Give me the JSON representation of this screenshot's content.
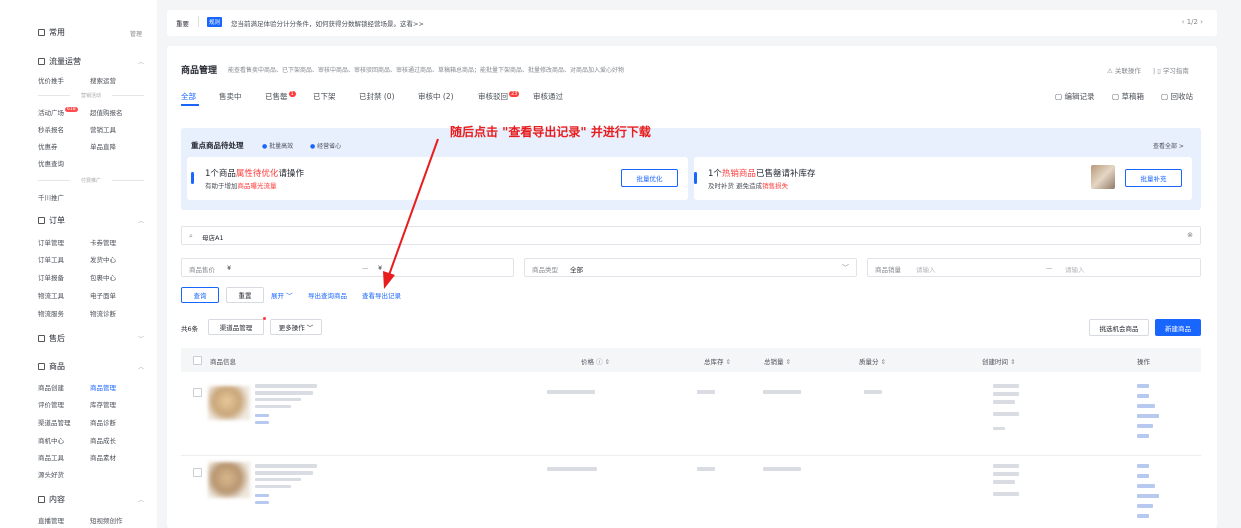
{
  "sidebar": {
    "common_title": "常用",
    "manage": "管理",
    "traffic_title": "流量运营",
    "row1a": "优价推手",
    "row1b": "搜索运营",
    "group_activity": "营销活动",
    "row2a": "活动广场",
    "row2a_badge": "618",
    "row2b": "超值购报名",
    "row3a": "秒杀报名",
    "row3b": "营销工具",
    "row4a": "优惠券",
    "row4b": "单品直降",
    "row5a": "优惠查询",
    "group_promo": "付费推广",
    "row6a": "千川推广",
    "order_title": "订单",
    "o1a": "订单管理",
    "o1b": "卡券管理",
    "o2a": "订单工具",
    "o2b": "发货中心",
    "o3a": "订单报备",
    "o3b": "包裹中心",
    "o4a": "物流工具",
    "o4b": "电子面单",
    "o5a": "物流服务",
    "o5b": "物流诊断",
    "after_title": "售后",
    "goods_title": "商品",
    "g1a": "商品创建",
    "g1b": "商品管理",
    "g2a": "评价管理",
    "g2b": "库存管理",
    "g3a": "渠道品管理",
    "g3b": "商品诊断",
    "g4a": "商机中心",
    "g4b": "商品成长",
    "g5a": "商品工具",
    "g5b": "商品素材",
    "g6a": "源头好货",
    "content_title": "内容",
    "c1a": "直播管理",
    "c1b": "短视频创作"
  },
  "notice": {
    "tag1": "重要",
    "tag2": "规则",
    "text": "您当前满足体验分计分条件，如何获得分数解锁经营场景。这看>>",
    "pager": "‹ 1/2 ›"
  },
  "page": {
    "title": "商品管理",
    "desc": "能查看售卖中商品、已下架商品、审核中商品、审核驳回商品、审核通过商品、草稿箱总商品；能批量下架商品、批量修改商品、对商品加入爱心好物",
    "link1": "关联操作",
    "link2": "学习指南"
  },
  "tabs": {
    "t1": "全部",
    "t2": "售卖中",
    "t3": "已售罄",
    "t3_badge": "1",
    "t4": "已下架",
    "t5": "已封禁 (0)",
    "t6": "审核中 (2)",
    "t7": "审核驳回",
    "t7_badge": "23",
    "t8": "审核通过",
    "r1": "编辑记录",
    "r2": "草稿箱",
    "r3": "回收站"
  },
  "pending": {
    "title": "重点商品待处理",
    "check1": "批量高效",
    "check2": "经营省心",
    "viewall": "查看全部 >",
    "c1_pre": "1个商品",
    "c1_hl": "属性待优化",
    "c1_post": "请操作",
    "c1_sub_pre": "有助于增加",
    "c1_sub_hl": "商品曝光流量",
    "c1_btn": "批量优化",
    "c2_pre": "1个",
    "c2_hl": "热销商品",
    "c2_post": "已售罄请补库存",
    "c2_sub_pre": "及时补货 避免造成",
    "c2_sub_hl": "销售损失",
    "c2_btn": "批量补充"
  },
  "annotation": "随后点击 \"查看导出记录\" 并进行下载",
  "filters": {
    "search_value": "母店A1",
    "price_label": "商品售价",
    "yen": "¥",
    "dash": "—",
    "type_label": "商品类型",
    "type_value": "全部",
    "sales_label": "商品销量",
    "sales_ph": "请输入"
  },
  "actions": {
    "query": "查询",
    "reset": "重置",
    "expand": "展开",
    "export": "导出查询商品",
    "export_record": "查看导出记录"
  },
  "list": {
    "total": "共6条",
    "channel": "渠道品管理",
    "more": "更多操作",
    "pick": "挑选机会商品",
    "create": "新建商品"
  },
  "table": {
    "h1": "商品信息",
    "h2": "价格",
    "h3": "总库存",
    "h4": "总销量",
    "h5": "质量分",
    "h6": "创建时间",
    "h7": "操作"
  },
  "colors": {
    "accent": "#1966ff",
    "red": "#ff3b3b",
    "annotation": "#e81c1c"
  }
}
